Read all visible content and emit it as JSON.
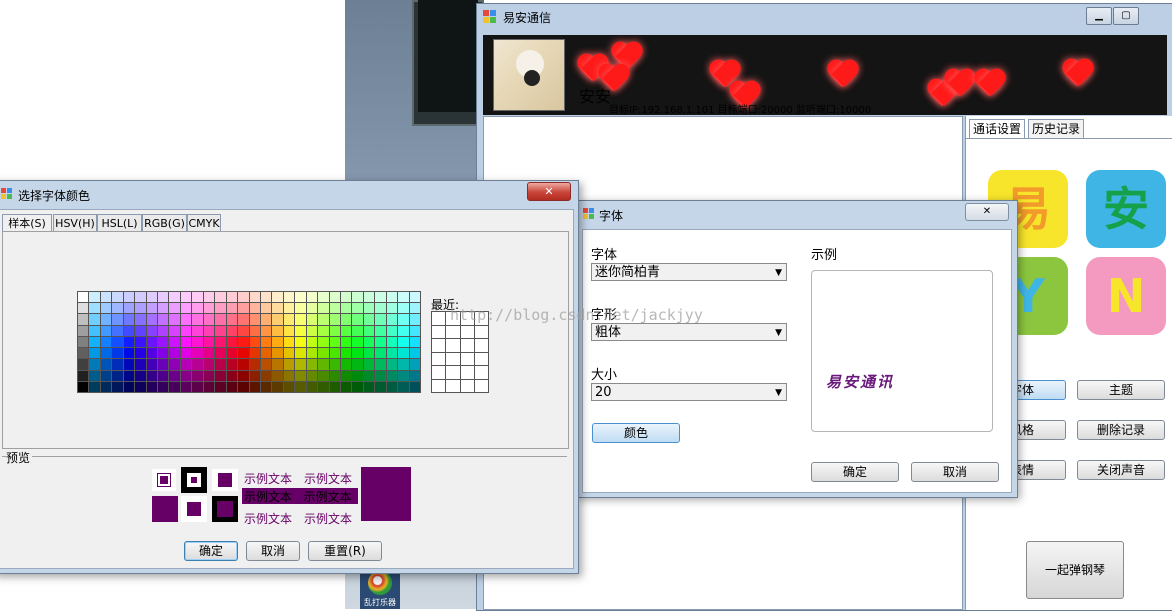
{
  "chat_window": {
    "title": "易安通信",
    "title_buttons": [
      "▭",
      "▢"
    ],
    "contact_name": "安安",
    "connection_info": "目标IP:192.168.1.101  目标端口:20000  监听端口:10000",
    "tabs": [
      "通话设置",
      "历史记录"
    ],
    "tiles": [
      "易",
      "安",
      "Y",
      "N"
    ],
    "buttons": {
      "font": "字体",
      "theme": "主题",
      "style": "风格",
      "delete_history": "删除记录",
      "emotion": "表情",
      "mute": "关闭声音",
      "piano": "一起弹钢琴"
    },
    "taskbar_label": "乱打乐器"
  },
  "font_dialog": {
    "title": "字体",
    "close": "✕",
    "font_label": "字体",
    "font_value": "迷你简柏青",
    "style_label": "字形",
    "style_value": "粗体",
    "size_label": "大小",
    "size_value": "20",
    "color_button": "颜色",
    "sample_label": "示例",
    "sample_text": "易安通讯",
    "ok": "确定",
    "cancel": "取消"
  },
  "watermark": "http://blog.csdn.net/jackjyy",
  "color_dialog": {
    "title": "选择字体颜色",
    "close": "✕",
    "tabs": [
      "样本(S)",
      "HSV(H)",
      "HSL(L)",
      "RGB(G)",
      "CMYK"
    ],
    "recent_label": "最近:",
    "preview_label": "预览",
    "example_text": "示例文本",
    "selected_color": "#660066",
    "ok": "确定",
    "cancel": "取消",
    "reset": "重置(R)"
  }
}
